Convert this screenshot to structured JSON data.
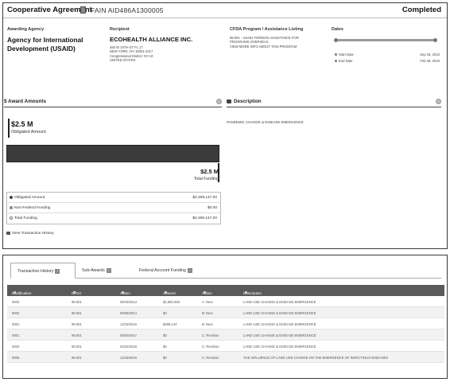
{
  "header": {
    "title": "Cooperative Agreement",
    "fain": "FAIN AID486A1300005",
    "status": "Completed"
  },
  "awarding_agency": {
    "label": "Awarding Agency",
    "name": "Agency for International Development (USAID)"
  },
  "recipient": {
    "label": "Recipient",
    "name": "ECOHEALTH ALLIANCE INC.",
    "address_lines": [
      "460 W 34TH ST FL 17",
      "NEW YORK, NY 10001-2317",
      "Congressional District: NY-10",
      "UNITED STATES"
    ]
  },
  "cfda": {
    "label": "CFDA Program / Assistance Listing",
    "lines": [
      "98.001 - USAID FOREIGN ASSISTANCE FOR",
      "PROGRAMS OVERSEAS",
      "VIEW MORE INFO ABOUT THIS PROGRAM"
    ]
  },
  "dates": {
    "label": "Dates",
    "progress": 1.0,
    "start_label": "Start Date",
    "start_value": "Sep 18, 2013",
    "end_label": "End Date",
    "end_value": "Feb 28, 2019"
  },
  "award_amounts": {
    "section_title": "$ Award Amounts",
    "obligated_short": "$2.5 M",
    "obligated_label": "Obligated Amount",
    "total_short": "$2.5 M",
    "total_label": "Total Funding",
    "rows": [
      {
        "name": "Obligated Amount",
        "value": "$2,499,147.00",
        "color": "#444444"
      },
      {
        "name": "Non-Federal Funding",
        "value": "$0.00",
        "color": "#888888"
      },
      {
        "name": "Total Funding",
        "value": "$2,499,147.00",
        "color": "#ffffff"
      }
    ],
    "view_history": "View Transaction History"
  },
  "description": {
    "section_title": "Description",
    "text": "PANDEMIC CHANGE & DISEASE EMERGENCE"
  },
  "tabs": [
    {
      "label": "Transaction History",
      "badge": "i"
    },
    {
      "label": "Sub-Awards",
      "badge": "i"
    },
    {
      "label": "Federal Account Funding",
      "badge": "i"
    }
  ],
  "transactions": {
    "columns": [
      "Modification Number",
      "CFDA Number",
      "Action Date",
      "Amount",
      "Action Type",
      "Description"
    ],
    "rows": [
      [
        "0003",
        "98.001",
        "09/18/2013",
        "$1,990,000",
        "A: New",
        "LAND USE CHANGE & DISEASE EMERGENCE"
      ],
      [
        "0002",
        "98.001",
        "09/08/2014",
        "$0",
        "B: New",
        "LAND USE CHANGE & DISEASE EMERGENCE"
      ],
      [
        "0001",
        "98.001",
        "12/19/2016",
        "$499,144",
        "B: New",
        "LAND USE CHANGE & DISEASE EMERGENCE"
      ],
      [
        "0001",
        "98.001",
        "09/20/2017",
        "$0",
        "C: Revision",
        "LAND USE CHANGE & DISEASE EMERGENCE"
      ],
      [
        "0004",
        "98.001",
        "04/23/2018",
        "$0",
        "C: Revision",
        "LAND USE CHANGE & DISEASE EMERGENCE"
      ],
      [
        "0005",
        "98.001",
        "12/19/2018",
        "$0",
        "C: Revision",
        "THE INFLUENCE OF LAND USE CHANGE ON THE EMERGENCE OF INFECTIOUS DISEASES"
      ]
    ]
  }
}
